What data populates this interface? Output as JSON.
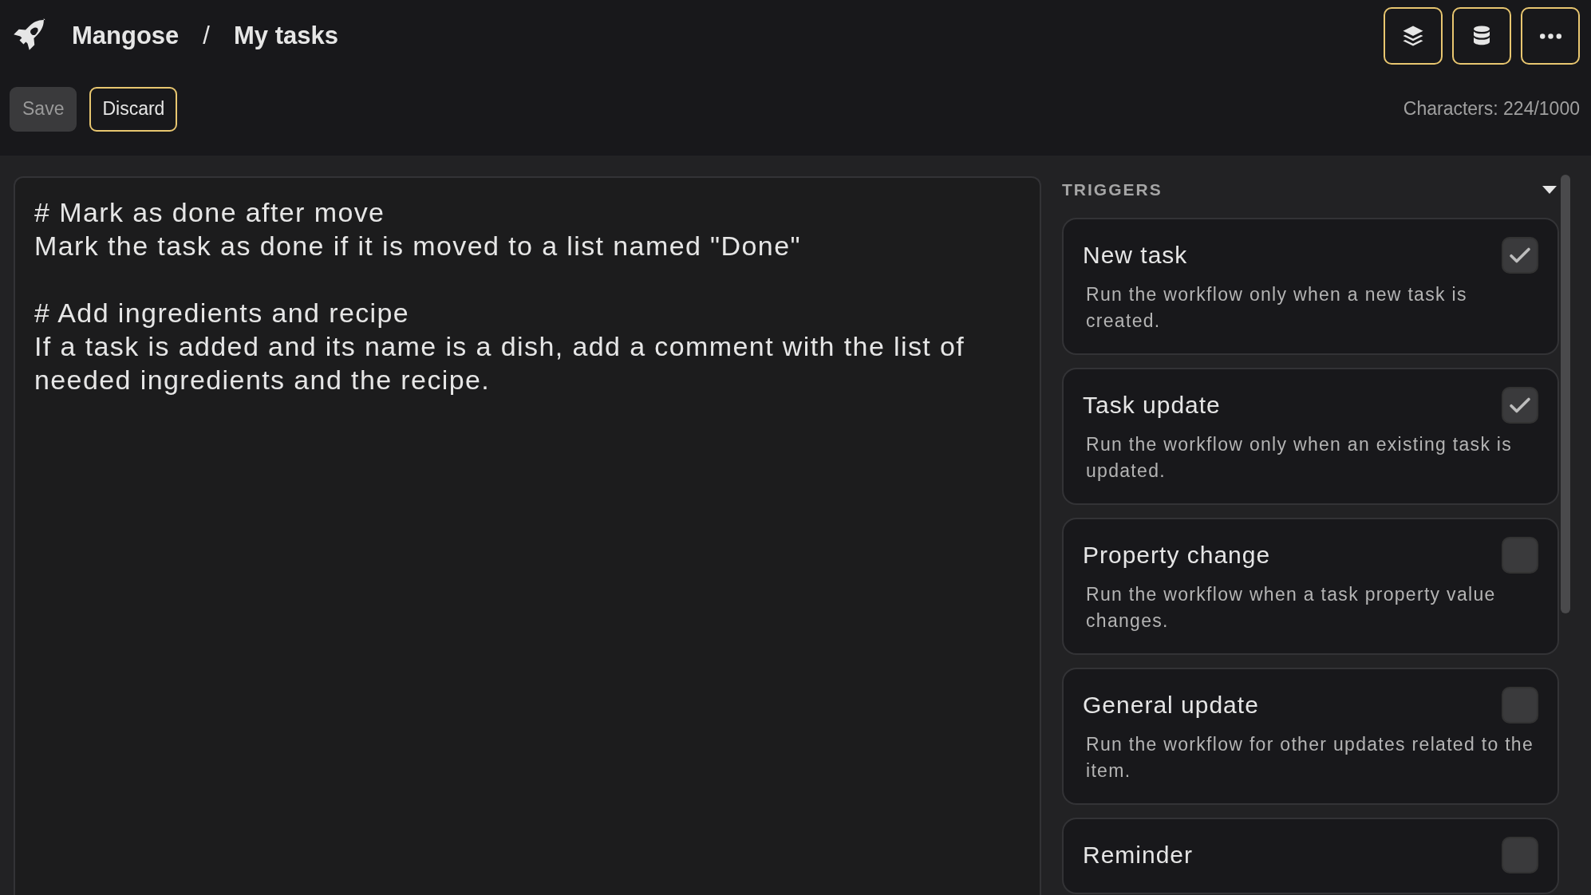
{
  "breadcrumb": {
    "workspace": "Mangose",
    "separator": "/",
    "page": "My tasks"
  },
  "header_actions": [
    {
      "kind": "layers"
    },
    {
      "kind": "database"
    },
    {
      "kind": "more"
    }
  ],
  "toolbar": {
    "save": {
      "label": "Save",
      "disabled": true
    },
    "discard": {
      "label": "Discard"
    },
    "character_count": "Characters: 224/1000"
  },
  "editor": {
    "text": "# Mark as done after move\nMark the task as done if it is moved to a list named \"Done\"\n\n# Add ingredients and recipe\nIf a task is added and its name is a dish, add a comment with the list of needed ingredients and the recipe."
  },
  "triggers": {
    "heading": "TRIGGERS",
    "expanded": true,
    "items": [
      {
        "title": "New task",
        "description": "Run the workflow only when a new task is created.",
        "checked": true
      },
      {
        "title": "Task update",
        "description": "Run the workflow only when an existing task is updated.",
        "checked": true
      },
      {
        "title": "Property change",
        "description": "Run the workflow when a task property value changes.",
        "checked": false
      },
      {
        "title": "General update",
        "description": "Run the workflow for other updates related to the item.",
        "checked": false
      },
      {
        "title": "Reminder",
        "checked": false
      }
    ]
  }
}
